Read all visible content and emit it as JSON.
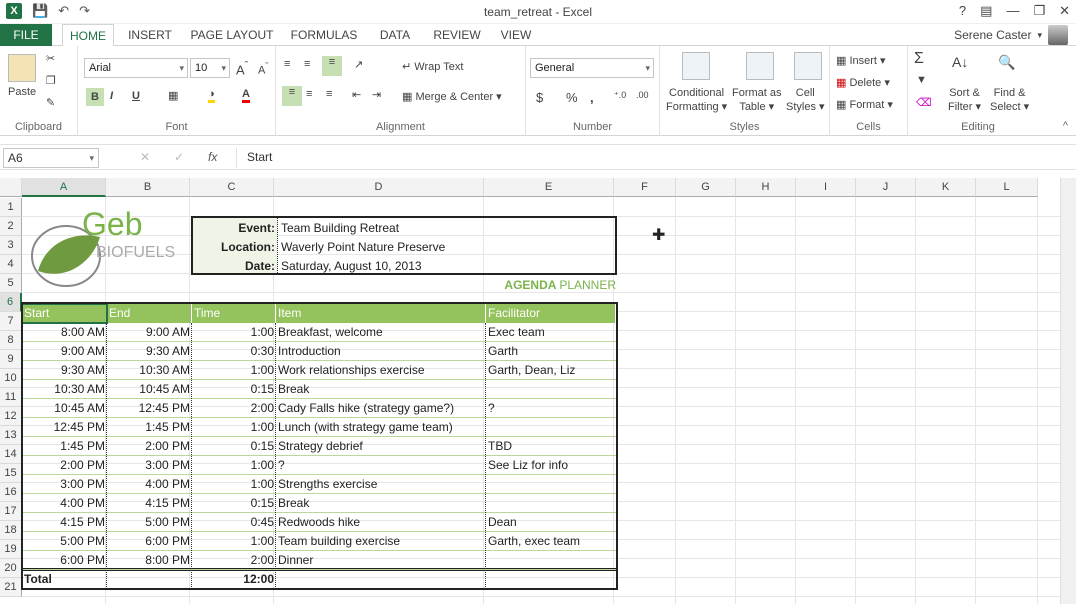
{
  "app": {
    "doc_title": "team_retreat - Excel",
    "user_name": "Serene Caster"
  },
  "tabs": [
    "FILE",
    "HOME",
    "INSERT",
    "PAGE LAYOUT",
    "FORMULAS",
    "DATA",
    "REVIEW",
    "VIEW"
  ],
  "ribbon": {
    "clipboard": {
      "paste": "Paste",
      "label": "Clipboard"
    },
    "font": {
      "family": "Arial",
      "size": "10",
      "label": "Font",
      "bold": "B",
      "italic": "I",
      "underline": "U"
    },
    "alignment": {
      "wrap_text": "Wrap Text",
      "merge_center": "Merge & Center",
      "label": "Alignment"
    },
    "number": {
      "format": "General",
      "currency": "$",
      "percent": "%",
      "comma": ",",
      "label": "Number"
    },
    "styles": {
      "conditional": "Conditional",
      "conditional2": "Formatting",
      "format_as": "Format as",
      "format_as2": "Table",
      "cell": "Cell",
      "cell2": "Styles",
      "label": "Styles"
    },
    "cells": {
      "insert": "Insert",
      "delete": "Delete",
      "format": "Format",
      "label": "Cells"
    },
    "editing": {
      "sort": "Sort &",
      "sort2": "Filter",
      "find": "Find &",
      "find2": "Select",
      "label": "Editing"
    }
  },
  "formula_bar": {
    "name_box": "A6",
    "fx": "fx",
    "content": "Start"
  },
  "columns": [
    "A",
    "B",
    "C",
    "D",
    "E",
    "F",
    "G",
    "H",
    "I",
    "J",
    "K",
    "L"
  ],
  "rows": [
    "1",
    "2",
    "3",
    "4",
    "5",
    "6",
    "7",
    "8",
    "9",
    "10",
    "11",
    "12",
    "13",
    "14",
    "15",
    "16",
    "17",
    "18",
    "19",
    "20",
    "21"
  ],
  "logo": {
    "text1": "Geb",
    "text2": "BIOFUELS"
  },
  "event_info": {
    "event_label": "Event:",
    "event_value": "Team Building Retreat",
    "location_label": "Location:",
    "location_value": "Waverly Point Nature Preserve",
    "date_label": "Date:",
    "date_value": "Saturday, August 10, 2013"
  },
  "agenda_title": {
    "part1": "AGENDA",
    "part2": "PLANNER"
  },
  "table_headers": [
    "Start",
    "End",
    "Time",
    "Item",
    "Facilitator"
  ],
  "agenda": [
    [
      "8:00 AM",
      "9:00 AM",
      "1:00",
      "Breakfast, welcome",
      "Exec team"
    ],
    [
      "9:00 AM",
      "9:30 AM",
      "0:30",
      "Introduction",
      "Garth"
    ],
    [
      "9:30 AM",
      "10:30 AM",
      "1:00",
      "Work relationships exercise",
      "Garth, Dean, Liz"
    ],
    [
      "10:30 AM",
      "10:45 AM",
      "0:15",
      "Break",
      ""
    ],
    [
      "10:45 AM",
      "12:45 PM",
      "2:00",
      "Cady Falls hike (strategy game?)",
      "?"
    ],
    [
      "12:45 PM",
      "1:45 PM",
      "1:00",
      "Lunch (with strategy game team)",
      ""
    ],
    [
      "1:45 PM",
      "2:00 PM",
      "0:15",
      "Strategy debrief",
      "TBD"
    ],
    [
      "2:00 PM",
      "3:00 PM",
      "1:00",
      "?",
      "See Liz for info"
    ],
    [
      "3:00 PM",
      "4:00 PM",
      "1:00",
      "Strengths exercise",
      ""
    ],
    [
      "4:00 PM",
      "4:15 PM",
      "0:15",
      "Break",
      ""
    ],
    [
      "4:15 PM",
      "5:00 PM",
      "0:45",
      "Redwoods hike",
      "Dean"
    ],
    [
      "5:00 PM",
      "6:00 PM",
      "1:00",
      "Team building exercise",
      "Garth, exec team"
    ],
    [
      "6:00 PM",
      "8:00 PM",
      "2:00",
      "Dinner",
      ""
    ]
  ],
  "total": {
    "label": "Total",
    "time": "12:00"
  }
}
